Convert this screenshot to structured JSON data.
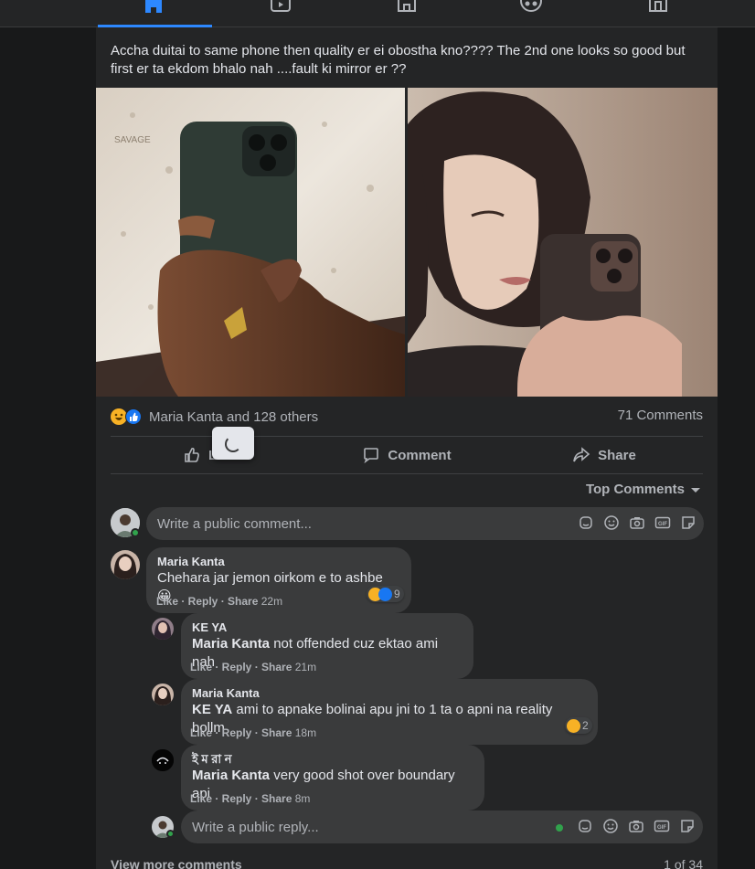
{
  "nav": {
    "items": [
      {
        "icon": "home-icon",
        "active": true
      },
      {
        "icon": "watch-icon",
        "active": false
      },
      {
        "icon": "marketplace-icon",
        "active": false
      },
      {
        "icon": "groups-icon",
        "active": false
      },
      {
        "icon": "gaming-icon",
        "active": false
      }
    ],
    "accent": "#2d88ff"
  },
  "post": {
    "text": "Accha duitai to same phone then quality er ei obostha kno???? The 2nd one looks so good but first er ta ekdom bhalo nah ....fault ki mirror er ??",
    "reactions_label": "Maria Kanta and 128 others",
    "comments_count": "71 Comments",
    "actions": {
      "like": "Like",
      "comment": "Comment",
      "share": "Share"
    },
    "sort_label": "Top Comments"
  },
  "comment_input": {
    "placeholder": "Write a public comment..."
  },
  "comments": [
    {
      "author": "Maria Kanta",
      "text": "Chehara jar jemon oirkom e to ashbe 😀",
      "actions": "Like · Reply · Share",
      "time": "22m",
      "reaction_count": "9",
      "replies": [
        {
          "author": "KE YA",
          "mention": "Maria Kanta",
          "text": " not offended cuz ektao ami nah",
          "actions": "Like · Reply · Share",
          "time": "21m"
        },
        {
          "author": "Maria Kanta",
          "mention": "KE YA",
          "text": " ami to apnake bolinai apu jni to 1 ta o apni na reality bollm",
          "actions": "Like · Reply · Share",
          "time": "18m",
          "reaction_count": "2"
        },
        {
          "author": "ই ম রা ন",
          "mention": "Maria Kanta",
          "text": " very good shot over boundary api",
          "actions": "Like · Reply · Share",
          "time": "8m"
        }
      ]
    }
  ],
  "reply_input": {
    "placeholder": "Write a public reply..."
  },
  "footer": {
    "view_more": "View more comments",
    "pager": "1 of 34"
  },
  "colors": {
    "background": "#18191a",
    "card": "#242526",
    "bubble": "#3a3b3c",
    "primary_text": "#e4e6eb",
    "secondary_text": "#b0b3b8",
    "like_blue": "#1877f2",
    "haha_yellow": "#f7b125",
    "online_green": "#31a24c"
  }
}
